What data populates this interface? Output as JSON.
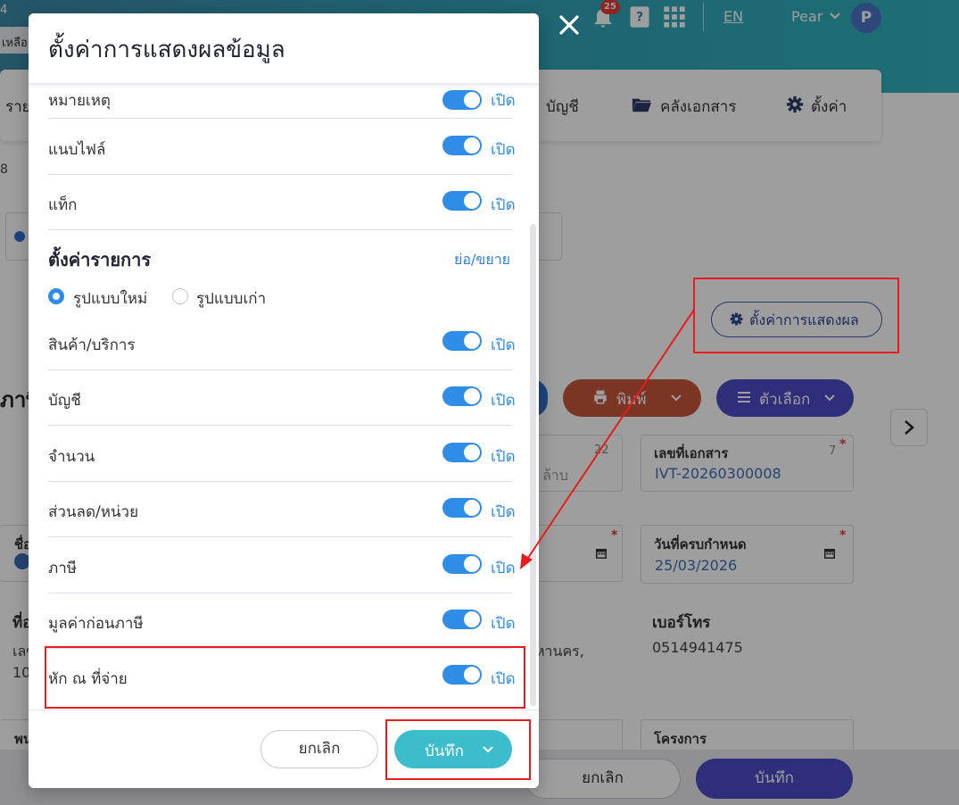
{
  "header": {
    "notification_count": "25",
    "language": "EN",
    "user_name": "Pear",
    "avatar_initial": "P",
    "top_left_number": "4",
    "top_left_text": "เหลือ"
  },
  "nav": {
    "items": [
      "ราย",
      "บัญชี",
      "คลังเอกสาร",
      "ตั้งค่า"
    ]
  },
  "background": {
    "display_settings_button": "ตั้งค่าการแสดงผล",
    "print_button": "พิมพ์",
    "options_button": "ตัวเลือก",
    "doc_number_label": "เลขที่เอกสาร",
    "doc_number_value": "IVT-20260300008",
    "doc_number_count": "7",
    "other_count": "22",
    "other_placeholder": "ล้าบ",
    "due_date_label": "วันที่ครบกำหนด",
    "due_date_value": "25/03/2026",
    "phone_label": "เบอร์โทร",
    "phone_value": "0514941475",
    "address_fragment": "หานคร,",
    "left_label_1": "ชื่อ",
    "left_label_2": "ที่อ",
    "left_text_1": "เลข",
    "left_text_2": "10",
    "left_label_3": "พน",
    "left_heading": "ภาษี",
    "left_number": "8",
    "project_label": "โครงการ",
    "cancel_button": "ยกเลิก",
    "save_button": "บันทึก"
  },
  "modal": {
    "title": "ตั้งค่าการแสดงผลข้อมูล",
    "top_rows": [
      {
        "label": "หมายเหตุ",
        "state": "เปิด"
      },
      {
        "label": "แนบไฟล์",
        "state": "เปิด"
      },
      {
        "label": "แท็ก",
        "state": "เปิด"
      }
    ],
    "item_section": {
      "title": "ตั้งค่ารายการ",
      "collapse_link": "ย่อ/ขยาย",
      "layout_options": [
        {
          "label": "รูปแบบใหม่",
          "selected": true
        },
        {
          "label": "รูปแบบเก่า",
          "selected": false
        }
      ],
      "rows": [
        {
          "label": "สินค้า/บริการ",
          "state": "เปิด"
        },
        {
          "label": "บัญชี",
          "state": "เปิด"
        },
        {
          "label": "จำนวน",
          "state": "เปิด"
        },
        {
          "label": "ส่วนลด/หน่วย",
          "state": "เปิด"
        },
        {
          "label": "ภาษี",
          "state": "เปิด"
        },
        {
          "label": "มูลค่าก่อนภาษี",
          "state": "เปิด"
        },
        {
          "label": "หัก ณ ที่จ่าย",
          "state": "เปิด"
        }
      ]
    },
    "footer": {
      "cancel": "ยกเลิก",
      "save": "บันทึก"
    }
  },
  "colors": {
    "toggle_on": "#2f8de8",
    "save_button": "#3dbccb",
    "annotation_red": "#e81c1c",
    "header_gradient_start": "#3c8aa6",
    "primary_purple": "#4c4bc6"
  },
  "icons": [
    "bell-icon",
    "help-icon",
    "apps-grid-icon",
    "chevron-down-icon",
    "folder-icon",
    "gear-icon",
    "close-icon",
    "print-icon",
    "menu-icon",
    "calendar-icon",
    "chevron-right-icon"
  ]
}
